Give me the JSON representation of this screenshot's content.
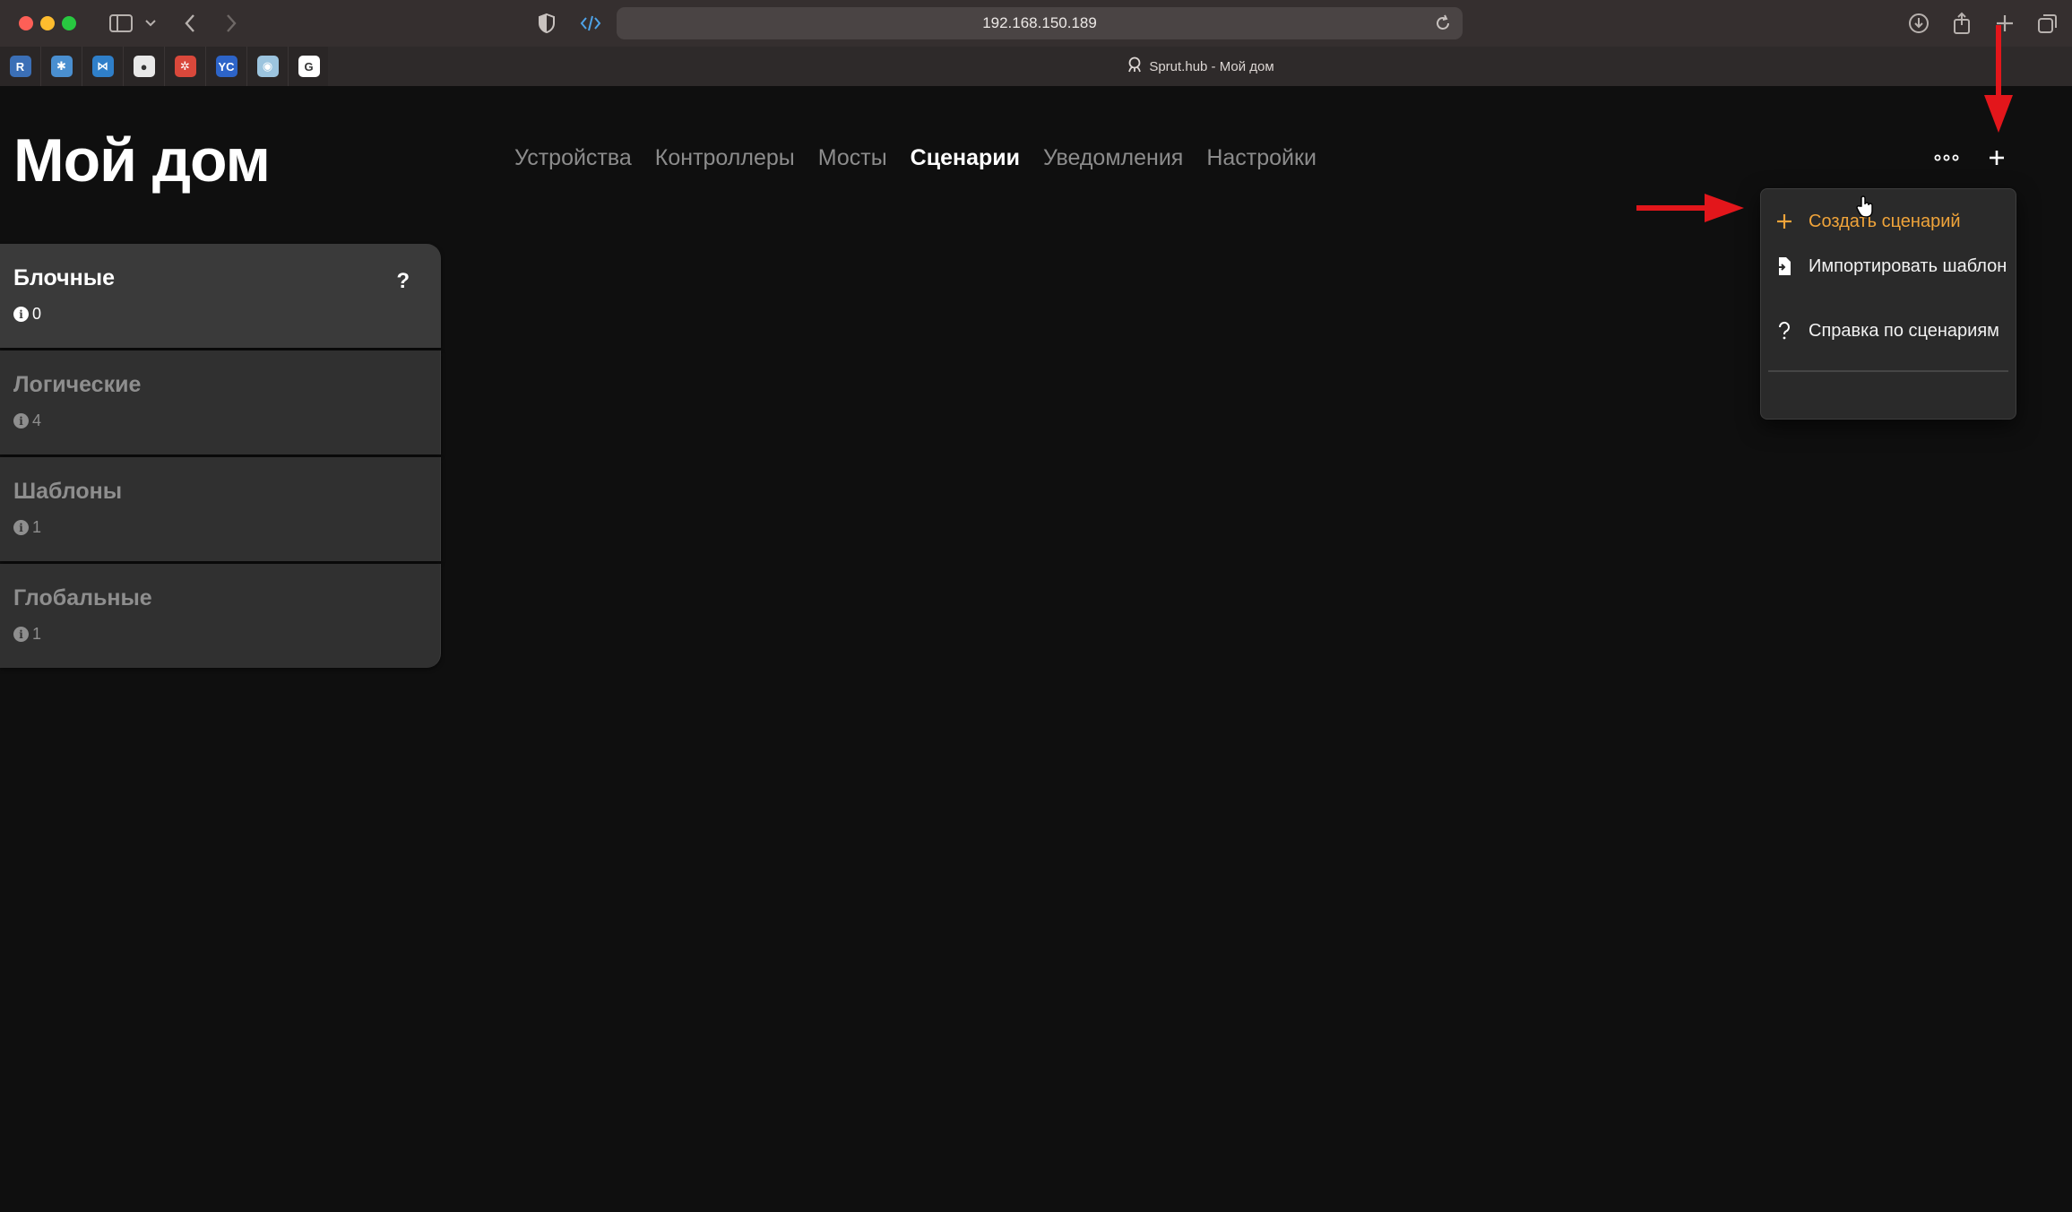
{
  "browser": {
    "url": "192.168.150.189",
    "tab_title": "Sprut.hub - Мой дом",
    "pinned_tabs": [
      {
        "icon": "r-icon",
        "glyph": "R",
        "color": "#3b6fb6"
      },
      {
        "icon": "snowflake-icon",
        "glyph": "✱",
        "color": "#4a8fd0"
      },
      {
        "icon": "vscode-icon",
        "glyph": "⋈",
        "color": "#2f7fc9"
      },
      {
        "icon": "github-icon",
        "glyph": "●",
        "color": "#e8e8e8"
      },
      {
        "icon": "bug-icon",
        "glyph": "✲",
        "color": "#d9483b"
      },
      {
        "icon": "yc-icon",
        "glyph": "YC",
        "color": "#2d64c8"
      },
      {
        "icon": "globe-icon",
        "glyph": "◉",
        "color": "#9cc4de"
      },
      {
        "icon": "google-icon",
        "glyph": "G",
        "color": "#ffffff"
      }
    ]
  },
  "header": {
    "title": "Мой дом",
    "nav": [
      {
        "label": "Устройства",
        "active": false
      },
      {
        "label": "Контроллеры",
        "active": false
      },
      {
        "label": "Мосты",
        "active": false
      },
      {
        "label": "Сценарии",
        "active": true
      },
      {
        "label": "Уведомления",
        "active": false
      },
      {
        "label": "Настройки",
        "active": false
      }
    ]
  },
  "sidebar": {
    "items": [
      {
        "label": "Блочные",
        "count": "0",
        "selected": true,
        "help": "?"
      },
      {
        "label": "Логические",
        "count": "4",
        "selected": false
      },
      {
        "label": "Шаблоны",
        "count": "1",
        "selected": false
      },
      {
        "label": "Глобальные",
        "count": "1",
        "selected": false
      }
    ]
  },
  "menu": {
    "items": [
      {
        "label": "Создать сценарий",
        "icon": "plus-icon",
        "accent": true
      },
      {
        "label": "Импортировать шаблон",
        "icon": "import-file-icon",
        "accent": false
      },
      {
        "label": "Справка по сценариям",
        "icon": "question-icon",
        "accent": false
      }
    ]
  },
  "colors": {
    "accent": "#f0a43a",
    "annotation_arrow": "#e3161b",
    "background": "#0f0f0f",
    "card": "#303030"
  }
}
